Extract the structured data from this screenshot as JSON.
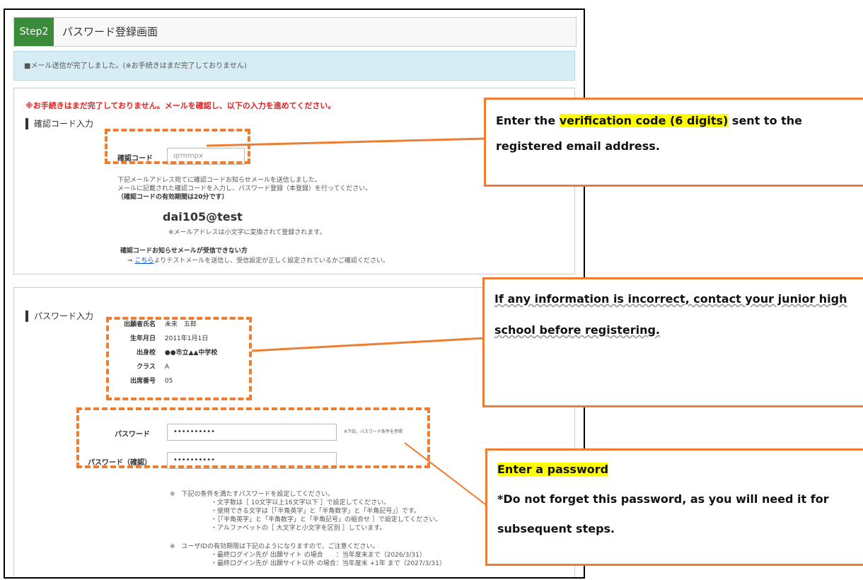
{
  "step": {
    "badge": "Step2",
    "title": "パスワード登録画面"
  },
  "notice": "■メール送信が完了しました。(※お手続きはまだ完了しておりません)",
  "verification": {
    "warning": "※お手続きはまだ完了しておりません。メールを確認し、以下の入力を進めてください。",
    "section_title": "確認コード入力",
    "code_label": "確認コード",
    "code_value": "qrmmpx",
    "desc1": "下記メールアドレス宛てに確認コードお知らせメールを送信しました。",
    "desc2": "メールに記載された確認コードを入力し、パスワード登録（本登録）を行ってください。",
    "desc3": "（確認コードの有効期間は20分です）",
    "email": "dai105@test",
    "email_note": "※メールアドレスは小文字に変換されて登録されます。",
    "help_title": "確認コードお知らせメールが受信できない方",
    "help_arrow": "⇒",
    "help_link": "こちら",
    "help_rest": "よりテストメールを送信し、受信設定が正しく設定されているかご確認ください。"
  },
  "password": {
    "section_title": "パスワード入力",
    "info": [
      {
        "label": "出願者氏名",
        "value": "未来　五郎"
      },
      {
        "label": "生年月日",
        "value": "2011年1月1日"
      },
      {
        "label": "出身校",
        "value": "●●市立▲▲中学校"
      },
      {
        "label": "クラス",
        "value": "A"
      },
      {
        "label": "出席番号",
        "value": "05"
      }
    ],
    "pw_label": "パスワード",
    "pw_value": "••••••••••",
    "pw_hint": "※下記、パスワード条件を参照",
    "pw_confirm_label": "パスワード（確認）",
    "pw_confirm_value": "••••••••••",
    "cond_intro": "※　下記の条件を満たすパスワードを設定してください。",
    "cond": [
      "・文字数は［ 10文字以上16文字以下 ］で設定してください。",
      "・使用できる文字は［「半角英字」と「半角数字」と「半角記号」］です。",
      "・［「半角英字」と「半角数字」と「半角記号」の組合せ ］で設定してください。",
      "・アルファベットの［ 大文字と小文字を区別 ］しています。"
    ],
    "expiry_intro": "※　ユーザIDの有効期限は下記のようになりますので、ご注意ください。",
    "expiry": [
      "・最終ログイン先が 出願サイト の場合　　：当年度末まで（2026/3/31）",
      "・最終ログイン先が 出願サイト以外 の場合：当年度末 +1年 まで（2027/3/31）"
    ]
  },
  "callouts": {
    "c1_pre": "Enter the ",
    "c1_hl": "verification code (6 digits)",
    "c1_post": " sent to the registered email address.",
    "c2": "If any information is incorrect, contact your junior high school before registering.",
    "c3_hl": "Enter a password",
    "c3_body": "*Do not forget this password, as you will need it for subsequent steps."
  },
  "colors": {
    "accent": "#ed7d31",
    "step_green": "#3a8c3a",
    "notice_bg": "#d7edf6",
    "warn_red": "#e02020",
    "highlight": "#ffff00"
  }
}
